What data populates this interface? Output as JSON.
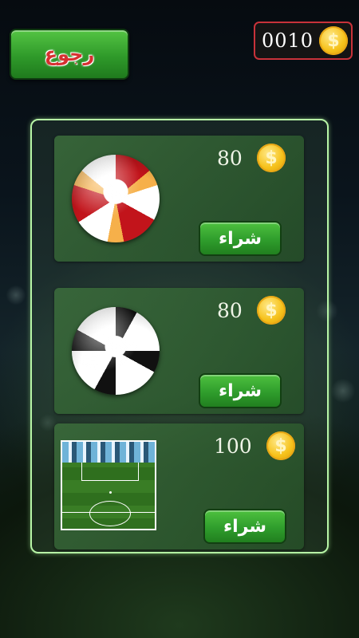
{
  "header": {
    "back_label": "رجوع",
    "coin_count": "0010",
    "coin_symbol": "$"
  },
  "shop": {
    "items": [
      {
        "kind": "ball-red-white",
        "price": "80",
        "coin_symbol": "$",
        "buy_label": "شراء"
      },
      {
        "kind": "ball-black-white",
        "price": "80",
        "coin_symbol": "$",
        "buy_label": "شراء"
      },
      {
        "kind": "stadium-pitch",
        "price": "100",
        "coin_symbol": "$",
        "buy_label": "شراء"
      }
    ]
  },
  "colors": {
    "button_green": "#2f9d2c",
    "panel_border": "#b7f5a6",
    "coin_gold": "#f6c21b",
    "coin_box_border": "#c8323a"
  }
}
